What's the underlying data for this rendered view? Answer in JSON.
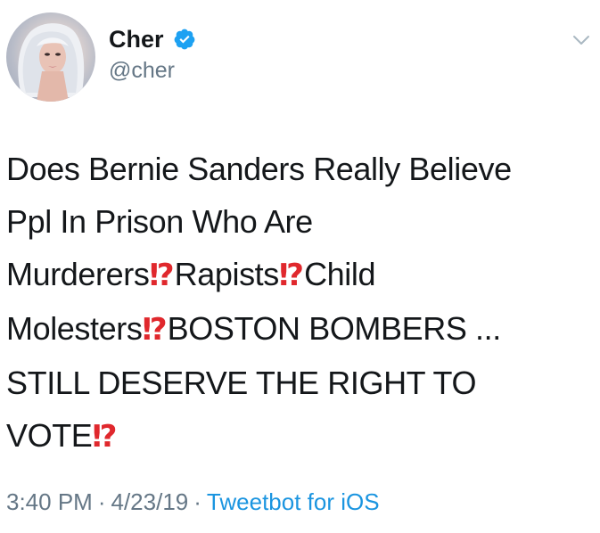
{
  "user": {
    "display_name": "Cher",
    "handle": "@cher",
    "verified": true,
    "avatar_icon": "profile-photo"
  },
  "tweet": {
    "lines": [
      [
        "Does Bernie Sanders Really Believe"
      ],
      [
        "Ppl In Prison Who  Are"
      ],
      [
        "Murderers",
        "⁉",
        "Rapists",
        "⁉",
        "Child"
      ],
      [
        "Molesters",
        "⁉",
        "BOSTON BOMBERS ..."
      ],
      [
        "STILL DESERVE THE RIGHT TO"
      ],
      [
        "VOTE",
        "⁉"
      ]
    ]
  },
  "meta": {
    "time": "3:40 PM",
    "separator": "·",
    "date": "4/23/19",
    "client": "Tweetbot for iOS"
  },
  "colors": {
    "text": "#14171a",
    "secondary": "#657786",
    "link": "#1b95e0",
    "verified": "#1da1f2",
    "emoji": "#e0282d"
  },
  "icons": {
    "verified": "verified-badge-icon",
    "menu": "chevron-down-icon"
  }
}
